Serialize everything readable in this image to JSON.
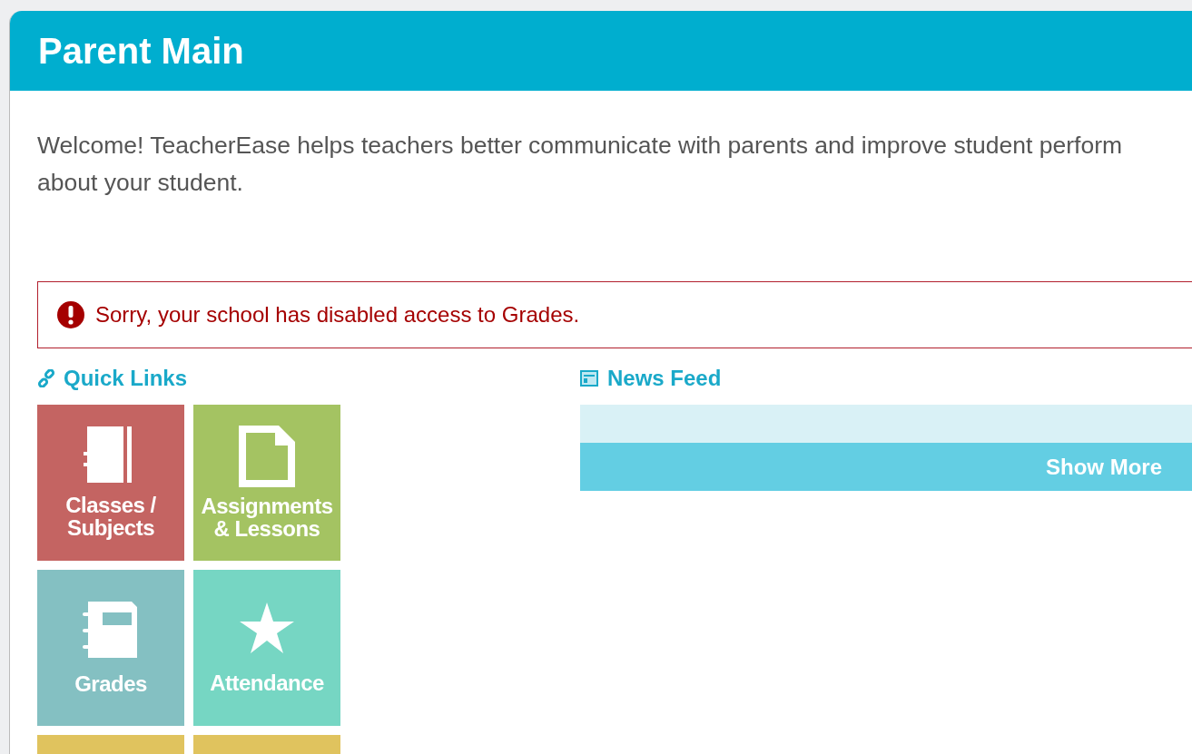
{
  "header": {
    "title": "Parent Main"
  },
  "welcome": {
    "lines": [
      "Welcome! TeacherEase helps teachers better communicate with parents and improve student perform",
      "about your student."
    ]
  },
  "alert": {
    "kind": "error",
    "text": "Sorry, your school has disabled access to Grades."
  },
  "quick_links": {
    "title": "Quick Links",
    "tiles": [
      {
        "label": [
          "Classes /",
          "Subjects"
        ],
        "kind": "notebook",
        "color": "#c46462"
      },
      {
        "label": [
          "Assignments",
          "& Lessons"
        ],
        "kind": "document",
        "color": "#a4c362"
      },
      {
        "label": [
          "Grades"
        ],
        "kind": "gradebook",
        "color": "#84c0c2"
      },
      {
        "label": [
          "Attendance"
        ],
        "kind": "star",
        "color": "#76d6c3"
      },
      {
        "kind": "blank",
        "color": "#e0c35e"
      },
      {
        "kind": "blank",
        "color": "#e0c35e"
      }
    ]
  },
  "news_feed": {
    "title": "News Feed",
    "button": "Show More"
  }
}
